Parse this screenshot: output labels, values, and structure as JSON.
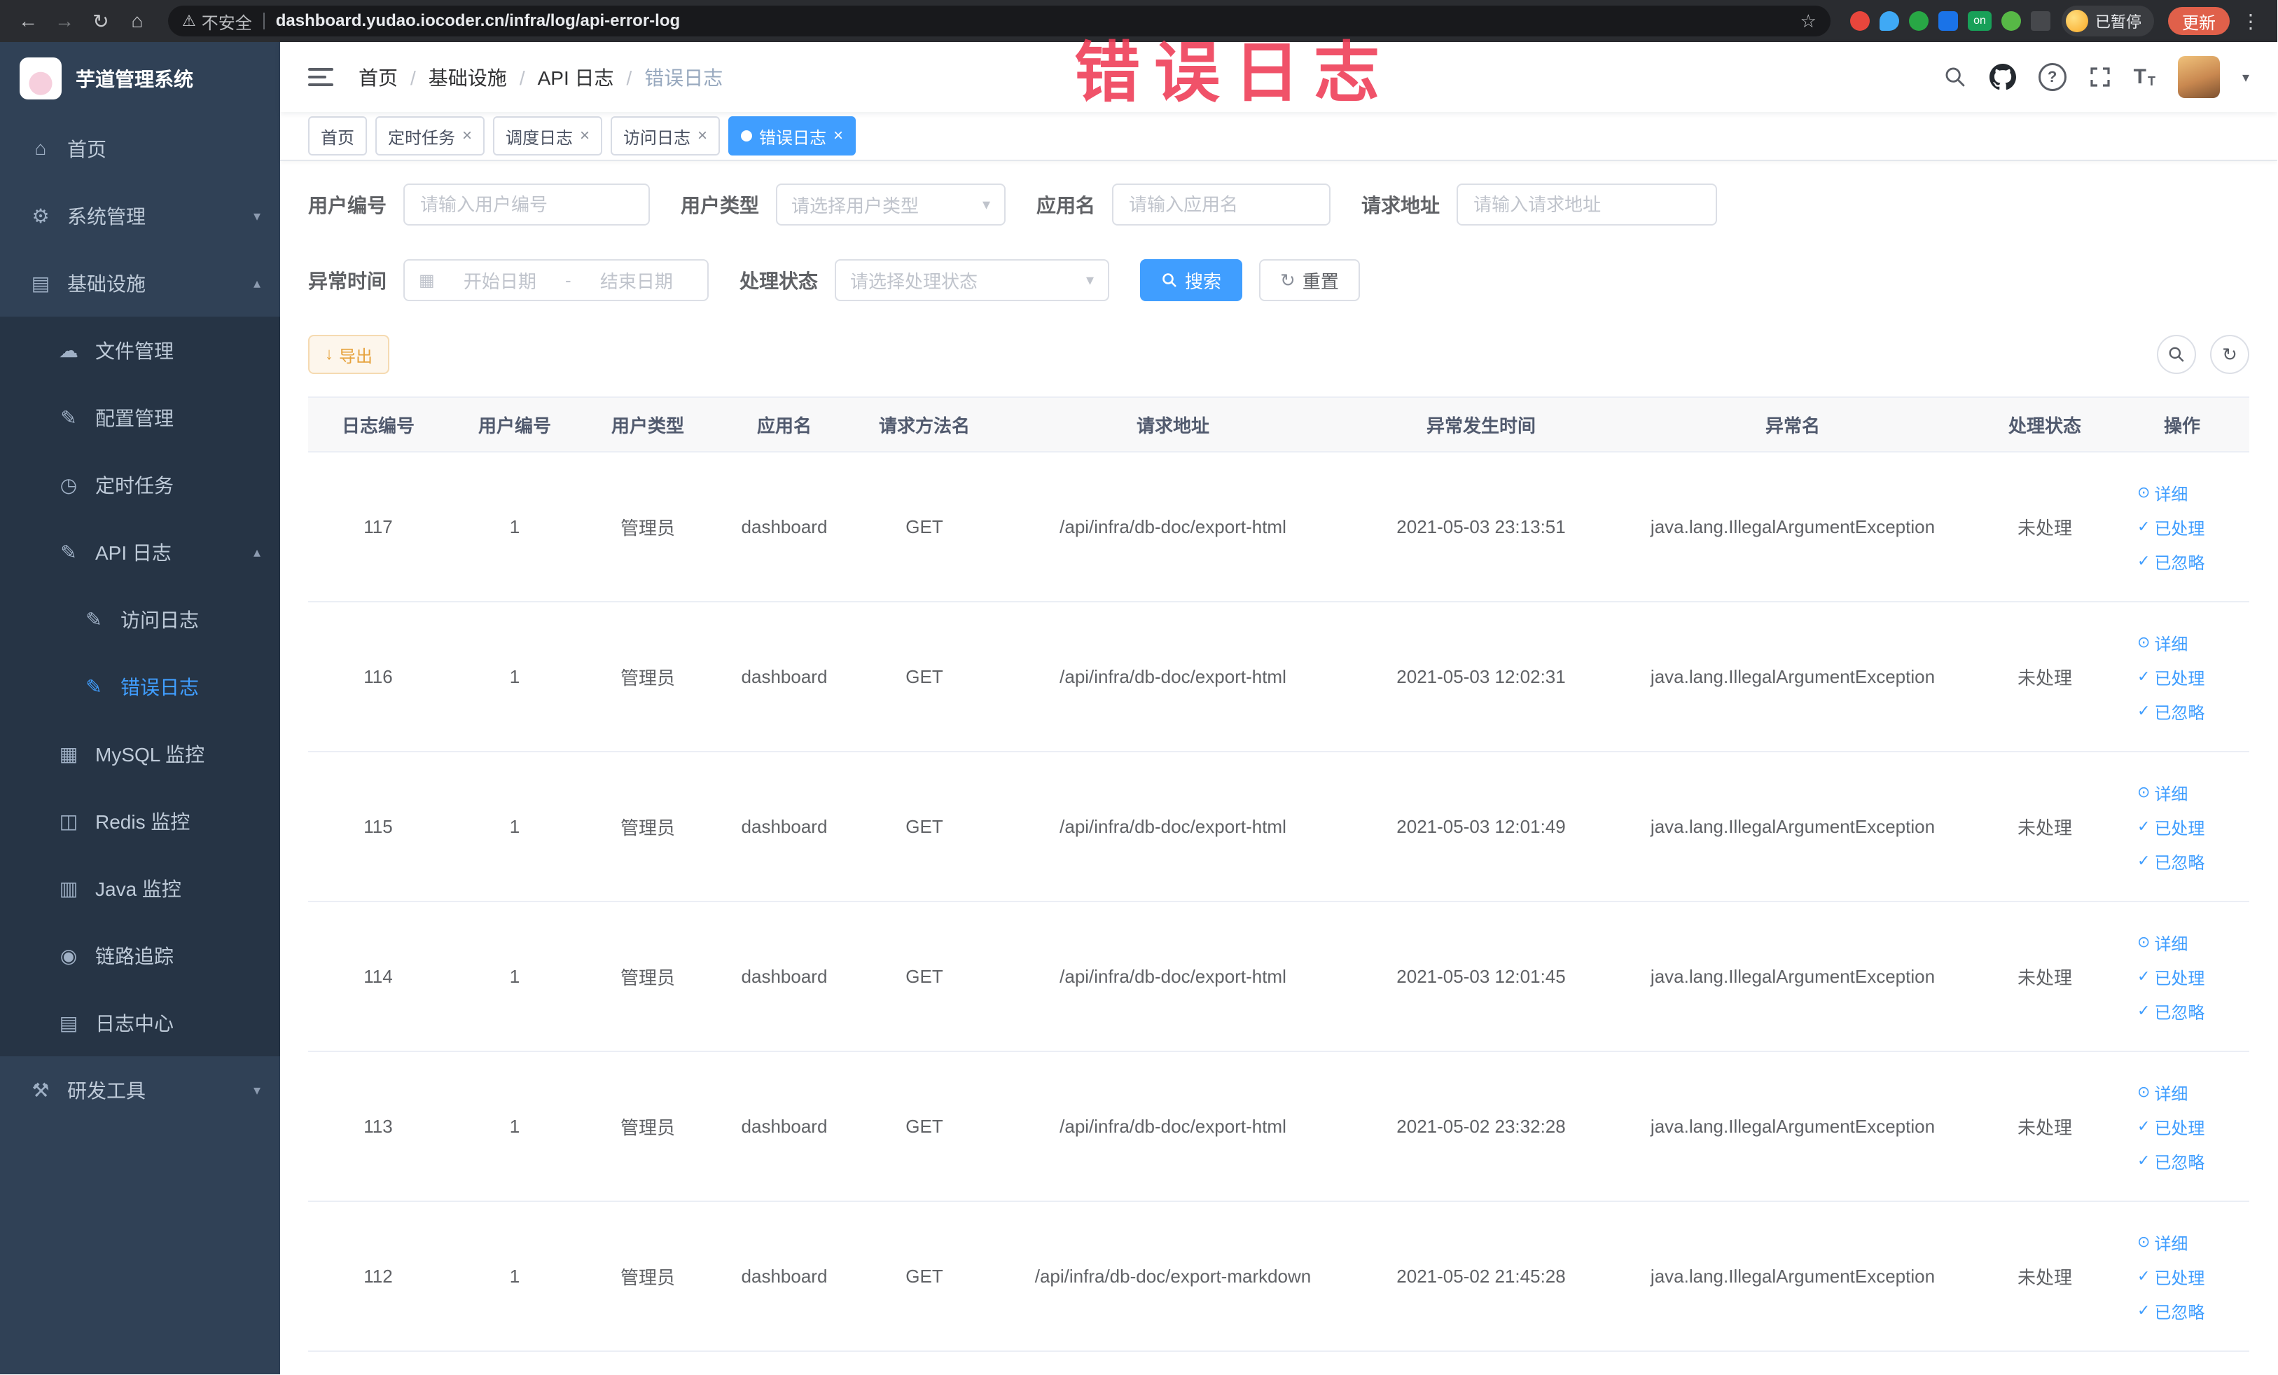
{
  "theme": {
    "primary": "#409eff",
    "warning": "#e6a23c",
    "sidebar_bg": "#304156",
    "submenu_bg": "#263445",
    "active_tab_bg": "#409eff",
    "watermark_color": "#ee3b55"
  },
  "watermark": "错误日志",
  "browser": {
    "security_label": "不安全",
    "url": "dashboard.yudao.iocoder.cn/infra/log/api-error-log",
    "ext_on_badge": "on",
    "profile_badge": "已暂停",
    "update_button": "更新"
  },
  "icons": {
    "back": "←",
    "forward": "→",
    "reload": "↻",
    "home": "⌂",
    "warning": "⚠",
    "star": "☆",
    "menu_dots": "⋮",
    "close": "×",
    "chevron_down": "▾",
    "chevron_up": "▴",
    "select_caret": "▾",
    "caret_down": "▾",
    "calendar": "▦",
    "check": "✓",
    "eye": "⊙",
    "download": "↓",
    "refresh": "↻",
    "question": "?",
    "font_large": "T",
    "font_small": "T",
    "menu_home": "⌂",
    "menu_gear": "⚙",
    "menu_infra": "▤",
    "menu_cloud": "☁",
    "menu_edit": "✎",
    "menu_clock": "◷",
    "menu_doc": "✎",
    "menu_mysql": "▦",
    "menu_redis": "◫",
    "menu_java": "▥",
    "menu_trace": "◉",
    "menu_logcenter": "▤",
    "menu_tools": "⚒"
  },
  "sidebar": {
    "logo_title": "芋道管理系统",
    "items": {
      "home": "首页",
      "system_mgmt": "系统管理",
      "infrastructure": "基础设施",
      "file_mgmt": "文件管理",
      "config_mgmt": "配置管理",
      "scheduled_jobs": "定时任务",
      "api_log": "API 日志",
      "access_log": "访问日志",
      "error_log": "错误日志",
      "mysql_monitor": "MySQL 监控",
      "redis_monitor": "Redis 监控",
      "java_monitor": "Java 监控",
      "tracing": "链路追踪",
      "log_center": "日志中心",
      "dev_tools": "研发工具"
    }
  },
  "breadcrumb": [
    "首页",
    "基础设施",
    "API 日志",
    "错误日志"
  ],
  "tabs": [
    {
      "label": "首页",
      "closable": false,
      "active": false
    },
    {
      "label": "定时任务",
      "closable": true,
      "active": false
    },
    {
      "label": "调度日志",
      "closable": true,
      "active": false
    },
    {
      "label": "访问日志",
      "closable": true,
      "active": false
    },
    {
      "label": "错误日志",
      "closable": true,
      "active": true
    }
  ],
  "filters": {
    "user_id": {
      "label": "用户编号",
      "placeholder": "请输入用户编号"
    },
    "user_type": {
      "label": "用户类型",
      "placeholder": "请选择用户类型"
    },
    "app_name": {
      "label": "应用名",
      "placeholder": "请输入应用名"
    },
    "request_url": {
      "label": "请求地址",
      "placeholder": "请输入请求地址"
    },
    "exception_time": {
      "label": "异常时间",
      "start_placeholder": "开始日期",
      "separator": "-",
      "end_placeholder": "结束日期"
    },
    "process_status": {
      "label": "处理状态",
      "placeholder": "请选择处理状态"
    },
    "search_button": "搜索",
    "reset_button": "重置"
  },
  "toolbar": {
    "export_button": "导出"
  },
  "table": {
    "headers": [
      "日志编号",
      "用户编号",
      "用户类型",
      "应用名",
      "请求方法名",
      "请求地址",
      "异常发生时间",
      "异常名",
      "处理状态",
      "操作"
    ],
    "actions": [
      "详细",
      "已处理",
      "已忽略"
    ],
    "rows": [
      {
        "log_id": "117",
        "user_id": "1",
        "user_type": "管理员",
        "app_name": "dashboard",
        "method": "GET",
        "url": "/api/infra/db-doc/export-html",
        "time": "2021-05-03 23:13:51",
        "exception": "java.lang.IllegalArgumentException",
        "status": "未处理"
      },
      {
        "log_id": "116",
        "user_id": "1",
        "user_type": "管理员",
        "app_name": "dashboard",
        "method": "GET",
        "url": "/api/infra/db-doc/export-html",
        "time": "2021-05-03 12:02:31",
        "exception": "java.lang.IllegalArgumentException",
        "status": "未处理"
      },
      {
        "log_id": "115",
        "user_id": "1",
        "user_type": "管理员",
        "app_name": "dashboard",
        "method": "GET",
        "url": "/api/infra/db-doc/export-html",
        "time": "2021-05-03 12:01:49",
        "exception": "java.lang.IllegalArgumentException",
        "status": "未处理"
      },
      {
        "log_id": "114",
        "user_id": "1",
        "user_type": "管理员",
        "app_name": "dashboard",
        "method": "GET",
        "url": "/api/infra/db-doc/export-html",
        "time": "2021-05-03 12:01:45",
        "exception": "java.lang.IllegalArgumentException",
        "status": "未处理"
      },
      {
        "log_id": "113",
        "user_id": "1",
        "user_type": "管理员",
        "app_name": "dashboard",
        "method": "GET",
        "url": "/api/infra/db-doc/export-html",
        "time": "2021-05-02 23:32:28",
        "exception": "java.lang.IllegalArgumentException",
        "status": "未处理"
      },
      {
        "log_id": "112",
        "user_id": "1",
        "user_type": "管理员",
        "app_name": "dashboard",
        "method": "GET",
        "url": "/api/infra/db-doc/export-markdown",
        "time": "2021-05-02 21:45:28",
        "exception": "java.lang.IllegalArgumentException",
        "status": "未处理"
      }
    ]
  }
}
